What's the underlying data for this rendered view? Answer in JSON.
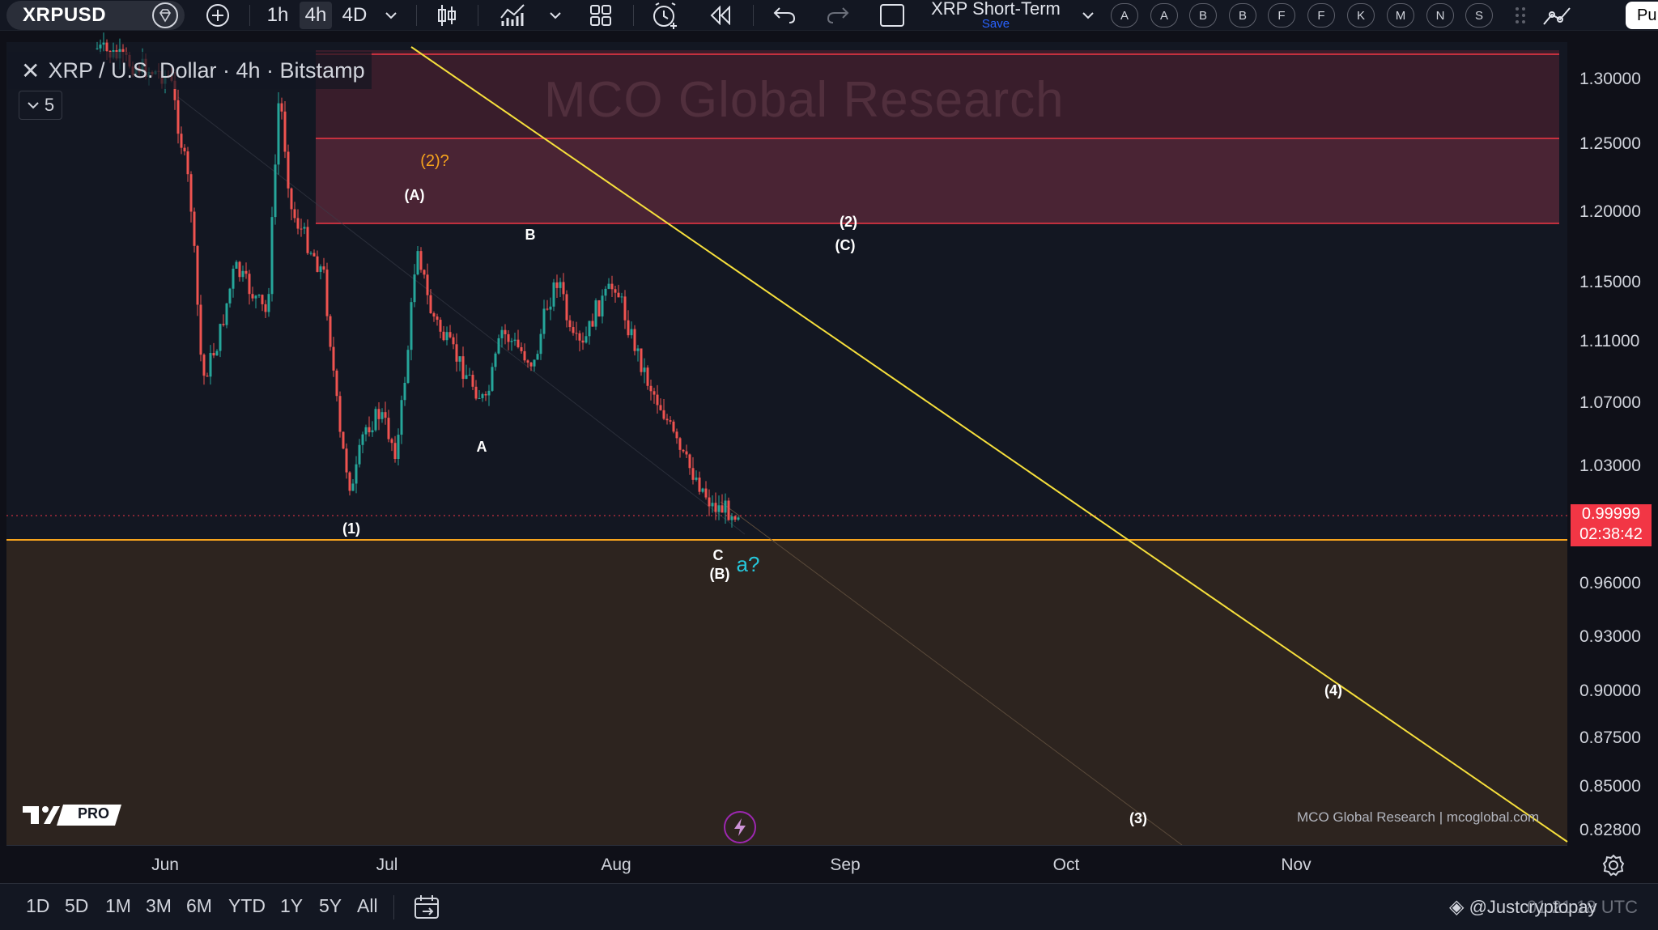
{
  "toolbar": {
    "symbol": "XRPUSD",
    "intervals": [
      "1h",
      "4h",
      "4D"
    ],
    "active_interval": "4h",
    "layout_name": "XRP Short-Term",
    "save_label": "Save",
    "alert_letters": [
      "A",
      "A",
      "B",
      "B",
      "F",
      "F",
      "K",
      "M",
      "N",
      "S"
    ],
    "publish_label": "Pu"
  },
  "legend": {
    "title": "XRP / U.S. Dollar · 4h · Bitstamp",
    "indicator_count": "5"
  },
  "watermark": "MCO Global Research",
  "price_axis": {
    "labels": [
      "1.30000",
      "1.25000",
      "1.20000",
      "1.15000",
      "1.11000",
      "1.07000",
      "1.03000",
      "0.96000",
      "0.93000",
      "0.90000",
      "0.87500",
      "0.85000",
      "0.82800"
    ],
    "current_price": "0.99999",
    "countdown": "02:38:42"
  },
  "time_axis": {
    "labels": [
      "Jun",
      "Jul",
      "Aug",
      "Sep",
      "Oct",
      "Nov"
    ]
  },
  "wave_labels": {
    "w2q": "(2)?",
    "wA_big": "(A)",
    "wB": "B",
    "w2": "(2)",
    "wC_big": "(C)",
    "wA": "A",
    "w1": "(1)",
    "wC": "C",
    "wB_big": "(B)",
    "wa_q": "a?",
    "w4": "(4)",
    "w3": "(3)"
  },
  "footer": {
    "credit": "MCO Global Research | mcoglobal.com",
    "tv_badge": "PRO"
  },
  "bottom_bar": {
    "ranges": [
      "1D",
      "5D",
      "1M",
      "3M",
      "6M",
      "YTD",
      "1Y",
      "5Y",
      "All"
    ],
    "copyright": "@Justcryptopay",
    "time": "01:21:18 UTC"
  },
  "colors": {
    "resistance_zone": "#4a2434",
    "support_zone": "#2d241f",
    "zone_line": "#f23645",
    "trendline": "#f7e03c",
    "support_line": "#f7a41d",
    "candle_up": "#26a69a",
    "candle_down": "#ef5350",
    "label_orange": "#f7a41d",
    "label_cyan": "#26c6da"
  }
}
